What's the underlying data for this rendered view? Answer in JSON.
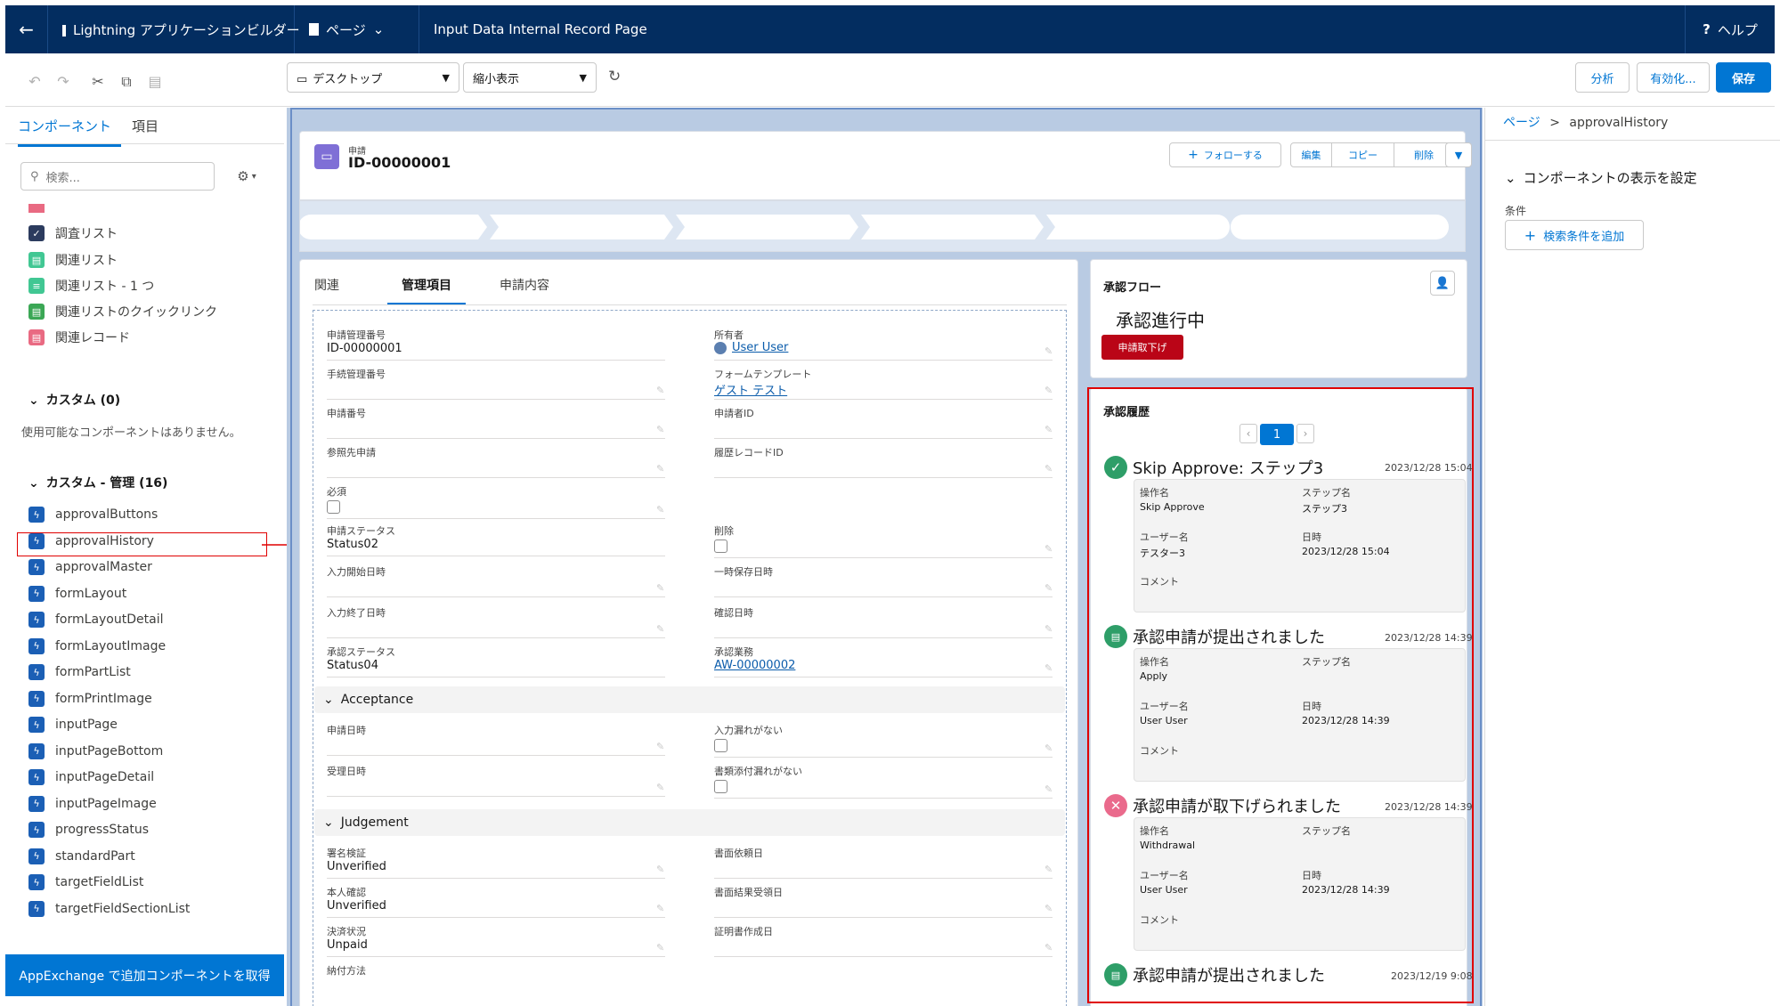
{
  "topbar": {
    "back_icon": "back-arrow-icon",
    "app_label": "Lightning アプリケーションビルダー",
    "page_menu": "ページ",
    "page_name": "Input Data Internal Record Page",
    "help": "ヘルプ"
  },
  "toolbar": {
    "device_select": "デスクトップ",
    "zoom_select": "縮小表示",
    "analyze": "分析",
    "activate": "有効化...",
    "save": "保存"
  },
  "left": {
    "tabs": [
      "コンポーネント",
      "項目"
    ],
    "search_placeholder": "検索...",
    "standard_items": [
      "関連リスト",
      "関連リスト - 1 つ",
      "関連リストのクイックリンク",
      "関連レコード"
    ],
    "truncated_item": "調査リスト",
    "custom_header": "カスタム (0)",
    "custom_empty": "使用可能なコンポーネントはありません。",
    "managed_header": "カスタム - 管理 (16)",
    "managed_items": [
      "approvalButtons",
      "approvalHistory",
      "approvalMaster",
      "formLayout",
      "formLayoutDetail",
      "formLayoutImage",
      "formPartList",
      "formPrintImage",
      "inputPage",
      "inputPageBottom",
      "inputPageDetail",
      "inputPageImage",
      "progressStatus",
      "standardPart",
      "targetFieldList",
      "targetFieldSectionList"
    ],
    "appexchange": "AppExchange で追加コンポーネントを取得"
  },
  "record": {
    "object_label": "申請",
    "record_name": "ID-00000001",
    "follow": "フォローする",
    "edit": "編集",
    "copy": "コピー",
    "delete": "削除"
  },
  "detail": {
    "tabs": [
      "関連",
      "管理項目",
      "申請内容"
    ],
    "fields": {
      "app_mgmt_no_label": "申請管理番号",
      "app_mgmt_no": "ID-00000001",
      "owner_label": "所有者",
      "owner": "User User",
      "proc_no_label": "手続管理番号",
      "form_tpl_label": "フォームテンプレート",
      "form_tpl": "ゲスト テスト",
      "app_no_label": "申請番号",
      "applicant_label": "申請者ID",
      "ref_label": "参照先申請",
      "hist_rec_label": "履歴レコードID",
      "required_label": "必須",
      "status_label": "申請ステータス",
      "status": "Status02",
      "del_label": "削除",
      "input_start_label": "入力開始日時",
      "temp_save_label": "一時保存日時",
      "input_end_label": "入力終了日時",
      "confirm_label": "確認日時",
      "appr_status_label": "承認ステータス",
      "appr_status": "Status04",
      "appr_task_label": "承認業務",
      "appr_task": "AW-00000002"
    },
    "sections": {
      "acceptance": "Acceptance",
      "judgement": "Judgement"
    },
    "acceptance_fields": {
      "app_date_label": "申請日時",
      "no_missing_label": "入力漏れがない",
      "recv_date_label": "受理日時",
      "no_attach_missing_label": "書類添付漏れがない"
    },
    "judgement_fields": {
      "sig_label": "署名検証",
      "sig": "Unverified",
      "doc_req_label": "書面依頼日",
      "identity_label": "本人確認",
      "identity": "Unverified",
      "doc_result_label": "書面結果受領日",
      "payment_label": "決済状況",
      "payment": "Unpaid",
      "cert_label": "証明書作成日",
      "pay_method_label": "納付方法"
    }
  },
  "flow": {
    "title": "承認フロー",
    "status": "承認進行中",
    "withdraw": "申請取下げ"
  },
  "history": {
    "title": "承認履歴",
    "page": "1",
    "entries": [
      {
        "title": "Skip Approve: ステップ3",
        "date": "2023/12/28 15:04",
        "op_label": "操作名",
        "op": "Skip Approve",
        "step_label": "ステップ名",
        "step": "ステップ3",
        "user_label": "ユーザー名",
        "user": "テスター3",
        "date_label": "日時",
        "date2": "2023/12/28 15:04",
        "comment_label": "コメント"
      },
      {
        "title": "承認申請が提出されました",
        "date": "2023/12/28 14:39",
        "op_label": "操作名",
        "op": "Apply",
        "step_label": "ステップ名",
        "step": "",
        "user_label": "ユーザー名",
        "user": "User User",
        "date_label": "日時",
        "date2": "2023/12/28 14:39",
        "comment_label": "コメント"
      },
      {
        "title": "承認申請が取下げられました",
        "date": "2023/12/28 14:39",
        "op_label": "操作名",
        "op": "Withdrawal",
        "step_label": "ステップ名",
        "step": "",
        "user_label": "ユーザー名",
        "user": "User User",
        "date_label": "日時",
        "date2": "2023/12/28 14:39",
        "comment_label": "コメント"
      },
      {
        "title": "承認申請が提出されました",
        "date": "2023/12/19 9:08"
      }
    ]
  },
  "right": {
    "breadcrumb_root": "ページ",
    "breadcrumb_sep": ">",
    "breadcrumb_current": "approvalHistory",
    "visibility_header": "コンポーネントの表示を設定",
    "condition_label": "条件",
    "add_filter": "検索条件を追加"
  },
  "colors": {
    "nav_bg": "#032d60",
    "brand": "#0176d3",
    "highlight": "#e00000",
    "withdraw_btn": "#ba0517"
  }
}
